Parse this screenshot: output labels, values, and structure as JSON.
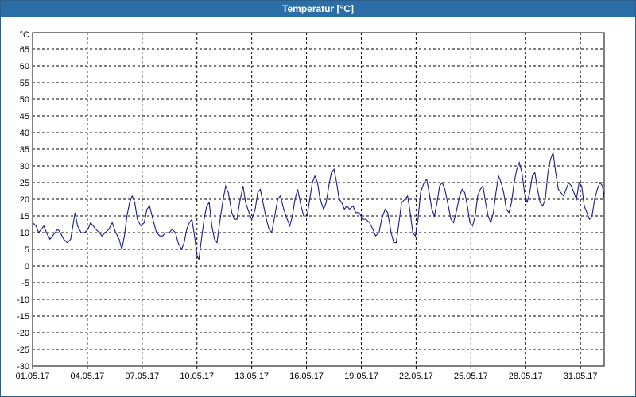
{
  "window": {
    "title": "Temperatur [°C]"
  },
  "colors": {
    "line": "#1a1a8c",
    "grid": "#000000",
    "titlebar": "#2b6ea7"
  },
  "chart_data": {
    "type": "line",
    "title": "Temperatur [°C]",
    "ylabel": "°C",
    "xlabel": "",
    "ylim": [
      -30,
      70
    ],
    "yticks": [
      -30,
      -25,
      -20,
      -15,
      -10,
      -5,
      0,
      5,
      10,
      15,
      20,
      25,
      30,
      35,
      40,
      45,
      50,
      55,
      60,
      65
    ],
    "xlim_days": [
      0,
      31
    ],
    "xticks": [
      {
        "label": "01.05.17",
        "day": 0
      },
      {
        "label": "04.05.17",
        "day": 3
      },
      {
        "label": "07.05.17",
        "day": 6
      },
      {
        "label": "10.05.17",
        "day": 9
      },
      {
        "label": "13.05.17",
        "day": 12
      },
      {
        "label": "16.05.17",
        "day": 15
      },
      {
        "label": "19.05.17",
        "day": 18
      },
      {
        "label": "22.05.17",
        "day": 21
      },
      {
        "label": "25.05.17",
        "day": 24
      },
      {
        "label": "28.05.17",
        "day": 27
      },
      {
        "label": "31.05.17",
        "day": 30
      }
    ],
    "grid": true,
    "series": [
      {
        "color": "#1a1a8c",
        "points": [
          [
            0.0,
            13
          ],
          [
            0.2,
            12
          ],
          [
            0.35,
            10
          ],
          [
            0.5,
            11
          ],
          [
            0.65,
            12
          ],
          [
            0.8,
            10
          ],
          [
            1.0,
            8
          ],
          [
            1.15,
            9
          ],
          [
            1.3,
            10
          ],
          [
            1.45,
            11
          ],
          [
            1.6,
            10
          ],
          [
            1.8,
            8
          ],
          [
            2.0,
            7
          ],
          [
            2.2,
            8
          ],
          [
            2.45,
            16
          ],
          [
            2.6,
            12
          ],
          [
            2.8,
            10
          ],
          [
            3.0,
            10
          ],
          [
            3.2,
            11
          ],
          [
            3.35,
            13
          ],
          [
            3.5,
            12
          ],
          [
            3.65,
            11
          ],
          [
            3.85,
            10
          ],
          [
            4.0,
            9
          ],
          [
            4.2,
            10
          ],
          [
            4.4,
            11
          ],
          [
            4.6,
            13
          ],
          [
            4.8,
            10
          ],
          [
            5.0,
            8
          ],
          [
            5.15,
            5
          ],
          [
            5.3,
            9
          ],
          [
            5.45,
            15
          ],
          [
            5.6,
            19
          ],
          [
            5.75,
            21
          ],
          [
            5.9,
            19
          ],
          [
            6.05,
            14
          ],
          [
            6.25,
            12
          ],
          [
            6.45,
            13
          ],
          [
            6.6,
            17
          ],
          [
            6.75,
            18
          ],
          [
            6.95,
            14
          ],
          [
            7.15,
            10
          ],
          [
            7.35,
            9
          ],
          [
            7.5,
            9
          ],
          [
            7.7,
            10
          ],
          [
            7.9,
            10
          ],
          [
            8.05,
            11
          ],
          [
            8.25,
            10
          ],
          [
            8.4,
            7
          ],
          [
            8.6,
            5
          ],
          [
            8.75,
            7
          ],
          [
            8.9,
            11
          ],
          [
            9.05,
            13
          ],
          [
            9.2,
            14
          ],
          [
            9.35,
            9
          ],
          [
            9.5,
            3
          ],
          [
            9.6,
            2
          ],
          [
            9.75,
            8
          ],
          [
            9.9,
            14
          ],
          [
            10.05,
            18
          ],
          [
            10.2,
            19
          ],
          [
            10.35,
            12
          ],
          [
            10.5,
            8
          ],
          [
            10.65,
            7
          ],
          [
            10.8,
            13
          ],
          [
            11.0,
            20
          ],
          [
            11.15,
            24
          ],
          [
            11.3,
            22
          ],
          [
            11.5,
            16
          ],
          [
            11.65,
            14
          ],
          [
            11.8,
            14
          ],
          [
            11.95,
            19
          ],
          [
            12.15,
            24
          ],
          [
            12.3,
            19
          ],
          [
            12.5,
            16
          ],
          [
            12.65,
            14
          ],
          [
            12.85,
            17
          ],
          [
            13.0,
            22
          ],
          [
            13.15,
            23
          ],
          [
            13.3,
            19
          ],
          [
            13.5,
            14
          ],
          [
            13.65,
            11
          ],
          [
            13.8,
            10
          ],
          [
            13.95,
            14
          ],
          [
            14.15,
            20
          ],
          [
            14.3,
            21
          ],
          [
            14.5,
            17
          ],
          [
            14.7,
            14
          ],
          [
            14.85,
            12
          ],
          [
            15.0,
            15
          ],
          [
            15.15,
            20
          ],
          [
            15.3,
            23
          ],
          [
            15.5,
            18
          ],
          [
            15.65,
            15
          ],
          [
            15.85,
            15
          ],
          [
            16.0,
            20
          ],
          [
            16.15,
            25
          ],
          [
            16.3,
            27
          ],
          [
            16.45,
            25
          ],
          [
            16.6,
            20
          ],
          [
            16.8,
            17
          ],
          [
            16.95,
            19
          ],
          [
            17.1,
            24
          ],
          [
            17.25,
            28
          ],
          [
            17.4,
            29
          ],
          [
            17.55,
            25
          ],
          [
            17.7,
            20
          ],
          [
            17.85,
            19
          ],
          [
            18.0,
            17
          ],
          [
            18.15,
            18
          ],
          [
            18.3,
            17
          ],
          [
            18.5,
            18
          ],
          [
            18.65,
            16
          ],
          [
            18.85,
            16
          ],
          [
            19.05,
            14
          ],
          [
            19.25,
            14
          ],
          [
            19.45,
            13
          ],
          [
            19.65,
            11
          ],
          [
            19.8,
            9
          ],
          [
            20.0,
            10
          ],
          [
            20.15,
            14
          ],
          [
            20.35,
            17
          ],
          [
            20.5,
            16
          ],
          [
            20.7,
            10
          ],
          [
            20.85,
            7
          ],
          [
            21.0,
            7
          ],
          [
            21.15,
            13
          ],
          [
            21.3,
            19
          ],
          [
            21.5,
            20
          ],
          [
            21.65,
            21
          ],
          [
            21.8,
            16
          ],
          [
            21.95,
            10
          ],
          [
            22.1,
            9
          ],
          [
            22.25,
            14
          ],
          [
            22.4,
            22
          ],
          [
            22.6,
            25
          ],
          [
            22.75,
            26
          ],
          [
            22.9,
            22
          ],
          [
            23.05,
            17
          ],
          [
            23.2,
            15
          ],
          [
            23.35,
            19
          ],
          [
            23.5,
            24
          ],
          [
            23.65,
            25
          ],
          [
            23.8,
            23
          ],
          [
            24.0,
            18
          ],
          [
            24.15,
            14
          ],
          [
            24.3,
            13
          ],
          [
            24.45,
            16
          ],
          [
            24.65,
            21
          ],
          [
            24.8,
            23
          ],
          [
            24.95,
            22
          ],
          [
            25.1,
            18
          ],
          [
            25.25,
            13
          ],
          [
            25.4,
            12
          ],
          [
            25.55,
            15
          ],
          [
            25.7,
            21
          ],
          [
            25.85,
            23
          ],
          [
            26.0,
            24
          ],
          [
            26.15,
            19
          ],
          [
            26.3,
            15
          ],
          [
            26.45,
            13
          ],
          [
            26.6,
            16
          ],
          [
            26.75,
            22
          ],
          [
            26.9,
            27
          ],
          [
            27.05,
            25
          ],
          [
            27.2,
            22
          ],
          [
            27.35,
            17
          ],
          [
            27.5,
            16
          ],
          [
            27.65,
            19
          ],
          [
            27.8,
            25
          ],
          [
            27.95,
            29
          ],
          [
            28.1,
            31
          ],
          [
            28.25,
            28
          ],
          [
            28.4,
            22
          ],
          [
            28.55,
            19
          ],
          [
            28.7,
            22
          ],
          [
            28.85,
            27
          ],
          [
            29.0,
            28
          ],
          [
            29.15,
            23
          ],
          [
            29.3,
            19
          ],
          [
            29.45,
            18
          ],
          [
            29.6,
            20
          ],
          [
            29.75,
            28
          ],
          [
            29.9,
            32
          ],
          [
            30.05,
            34
          ],
          [
            30.2,
            28
          ],
          [
            30.35,
            23
          ],
          [
            30.5,
            22
          ],
          [
            30.65,
            21
          ],
          [
            30.8,
            23
          ],
          [
            30.95,
            25
          ],
          [
            31.1,
            24
          ],
          [
            31.25,
            22
          ],
          [
            31.4,
            20
          ],
          [
            31.55,
            25
          ],
          [
            31.7,
            24
          ],
          [
            31.85,
            18
          ],
          [
            32.0,
            16
          ],
          [
            32.15,
            14
          ],
          [
            32.3,
            15
          ],
          [
            32.45,
            20
          ],
          [
            32.6,
            23
          ],
          [
            32.75,
            25
          ],
          [
            32.9,
            24
          ],
          [
            33.0,
            20
          ]
        ]
      }
    ]
  }
}
